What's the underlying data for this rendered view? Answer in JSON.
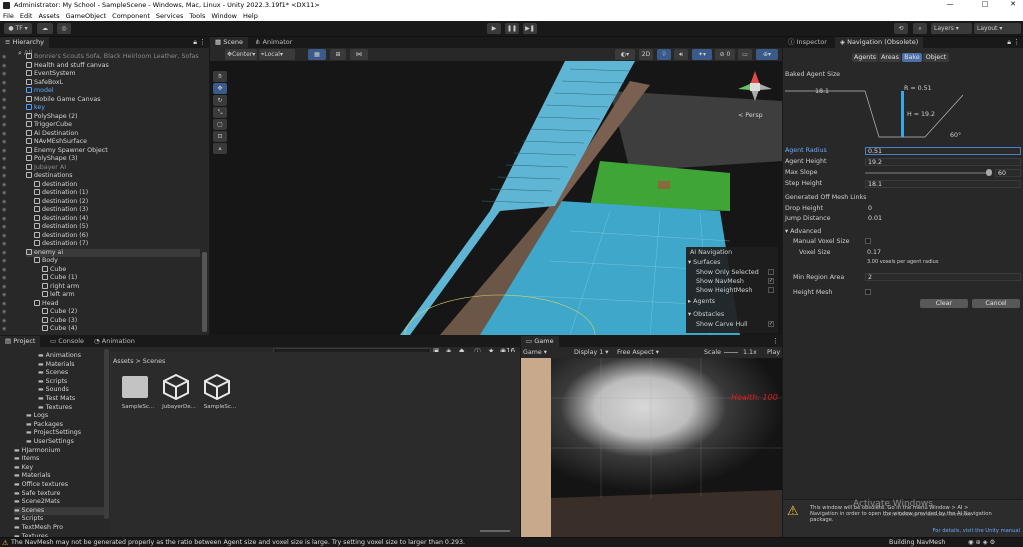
{
  "window": {
    "title": "Administrator: My School - SampleScene - Windows, Mac, Linux - Unity 2022.3.19f1* <DX11>",
    "minimize": "—",
    "maximize": "□",
    "close": "✕"
  },
  "menu": [
    "File",
    "Edit",
    "Assets",
    "GameObject",
    "Component",
    "Services",
    "Tools",
    "Window",
    "Help"
  ],
  "toolbar": {
    "account": "TF",
    "layers_label": "Layers",
    "layout_label": "Layout"
  },
  "hierarchy": {
    "tab": "Hierarchy",
    "search_placeholder": "All",
    "items": [
      {
        "label": "Bonnie's Scouts Sofa, Black Heirloom Leather, Sofas",
        "indent": 0,
        "style": "gray"
      },
      {
        "label": "Health and stuff canvas",
        "indent": 0,
        "style": ""
      },
      {
        "label": "EventSystem",
        "indent": 0,
        "style": ""
      },
      {
        "label": "SafeBoxL",
        "indent": 0,
        "style": ""
      },
      {
        "label": "model",
        "indent": 0,
        "style": "blue"
      },
      {
        "label": "Mobile Game Canvas",
        "indent": 0,
        "style": ""
      },
      {
        "label": "key",
        "indent": 0,
        "style": "blue"
      },
      {
        "label": "PolyShape (2)",
        "indent": 0,
        "style": ""
      },
      {
        "label": "TriggerCube",
        "indent": 0,
        "style": ""
      },
      {
        "label": "Ai Destination",
        "indent": 0,
        "style": ""
      },
      {
        "label": "NAvMEshSurface",
        "indent": 0,
        "style": ""
      },
      {
        "label": "Enemy Spawner Object",
        "indent": 0,
        "style": ""
      },
      {
        "label": "PolyShape (3)",
        "indent": 0,
        "style": ""
      },
      {
        "label": "Jubayer AI",
        "indent": 0,
        "style": "gray"
      },
      {
        "label": "destinations",
        "indent": 0,
        "style": ""
      },
      {
        "label": "destination",
        "indent": 1,
        "style": ""
      },
      {
        "label": "destination (1)",
        "indent": 1,
        "style": ""
      },
      {
        "label": "destination (2)",
        "indent": 1,
        "style": ""
      },
      {
        "label": "destination (3)",
        "indent": 1,
        "style": ""
      },
      {
        "label": "destination (4)",
        "indent": 1,
        "style": ""
      },
      {
        "label": "destination (5)",
        "indent": 1,
        "style": ""
      },
      {
        "label": "destination (6)",
        "indent": 1,
        "style": ""
      },
      {
        "label": "destination (7)",
        "indent": 1,
        "style": ""
      },
      {
        "label": "enemy ai",
        "indent": 0,
        "style": ""
      },
      {
        "label": "Body",
        "indent": 1,
        "style": ""
      },
      {
        "label": "Cube",
        "indent": 2,
        "style": ""
      },
      {
        "label": "Cube (1)",
        "indent": 2,
        "style": ""
      },
      {
        "label": "right arm",
        "indent": 2,
        "style": ""
      },
      {
        "label": "left arm",
        "indent": 2,
        "style": ""
      },
      {
        "label": "Head",
        "indent": 1,
        "style": ""
      },
      {
        "label": "Cube (2)",
        "indent": 2,
        "style": ""
      },
      {
        "label": "Cube (3)",
        "indent": 2,
        "style": ""
      },
      {
        "label": "Cube (4)",
        "indent": 2,
        "style": ""
      }
    ]
  },
  "scene": {
    "tabs": [
      "Scene",
      "Animator"
    ],
    "pivot": "Center",
    "space": "Local",
    "mode_2d": "2D",
    "persp": "< Persp",
    "ai_nav": {
      "title": "AI Navigation",
      "surfaces": "Surfaces",
      "show_only_selected": "Show Only Selected",
      "show_navmesh": "Show NavMesh",
      "show_heightmesh": "Show HeightMesh",
      "agents": "Agents",
      "obstacles": "Obstacles",
      "show_carve_hull": "Show Carve Hull",
      "check": "✓"
    }
  },
  "inspector": {
    "tabs": [
      "Inspector",
      "Navigation (Obsolete)"
    ],
    "subtabs": [
      "Agents",
      "Areas",
      "Bake",
      "Object"
    ],
    "baked_agent_size": "Baked Agent Size",
    "diagram": {
      "r": "R = 0.51",
      "h": "H = 19.2",
      "width": "18.1",
      "angle": "60°"
    },
    "fields": [
      {
        "label": "Agent Radius",
        "value": "0.51"
      },
      {
        "label": "Agent Height",
        "value": "19.2"
      },
      {
        "label": "Max Slope",
        "value": "60"
      },
      {
        "label": "Step Height",
        "value": "18.1"
      }
    ],
    "offmesh_header": "Generated Off Mesh Links",
    "drop_height": {
      "label": "Drop Height",
      "value": "0"
    },
    "jump_distance": {
      "label": "Jump Distance",
      "value": "0.01"
    },
    "advanced": "Advanced",
    "manual_voxel": "Manual Voxel Size",
    "voxel_size": {
      "label": "Voxel Size",
      "value": "0.17"
    },
    "voxel_hint": "3.00 voxels per agent radius",
    "min_region": {
      "label": "Min Region Area",
      "value": "2"
    },
    "height_mesh": "Height Mesh",
    "clear": "Clear",
    "cancel": "Cancel",
    "warning": "This window will be obsolete. Go in the menu Window > AI > Navigation in order to open the window provided by the AI Navigation package.",
    "details": "For details, visit the Unity manual",
    "activate1": "Activate Windows",
    "activate2": "Go to Settings to activate Windows."
  },
  "project": {
    "tabs": [
      "Project",
      "Console",
      "Animation"
    ],
    "tree": [
      {
        "label": "Animations",
        "indent": 2
      },
      {
        "label": "Materials",
        "indent": 2
      },
      {
        "label": "Scenes",
        "indent": 2
      },
      {
        "label": "Scripts",
        "indent": 2
      },
      {
        "label": "Sounds",
        "indent": 2
      },
      {
        "label": "Test Mats",
        "indent": 2
      },
      {
        "label": "Textures",
        "indent": 2
      },
      {
        "label": "Logs",
        "indent": 1
      },
      {
        "label": "Packages",
        "indent": 1
      },
      {
        "label": "ProjectSettings",
        "indent": 1
      },
      {
        "label": "UserSettings",
        "indent": 1
      },
      {
        "label": "HJarmonium",
        "indent": 0
      },
      {
        "label": "Items",
        "indent": 0
      },
      {
        "label": "Key",
        "indent": 0
      },
      {
        "label": "Materials",
        "indent": 0
      },
      {
        "label": "Office textures",
        "indent": 0
      },
      {
        "label": "Safe texture",
        "indent": 0
      },
      {
        "label": "Scene2Mats",
        "indent": 0
      },
      {
        "label": "Scenes",
        "indent": 0
      },
      {
        "label": "Scripts",
        "indent": 0
      },
      {
        "label": "TextMesh Pro",
        "indent": 0
      },
      {
        "label": "Textures",
        "indent": 0
      }
    ],
    "breadcrumb": [
      "Assets",
      "Scenes"
    ],
    "assets": [
      {
        "label": "SampleSc...",
        "kind": "folder"
      },
      {
        "label": "JubayerDe...",
        "kind": "unity"
      },
      {
        "label": "SampleSc...",
        "kind": "unity"
      }
    ],
    "count": "16"
  },
  "game": {
    "tab": "Game",
    "display_mode": "Game",
    "display": "Display 1",
    "aspect": "Free Aspect",
    "scale_label": "Scale",
    "scale_value": "1.1x",
    "play": "Play",
    "health": "Health: 100"
  },
  "status": {
    "message": "The NavMesh may not be generated properly as the ratio between Agent size and voxel size is large. Try setting voxel size to larger than 0.293.",
    "right": "Building NavMesh"
  }
}
